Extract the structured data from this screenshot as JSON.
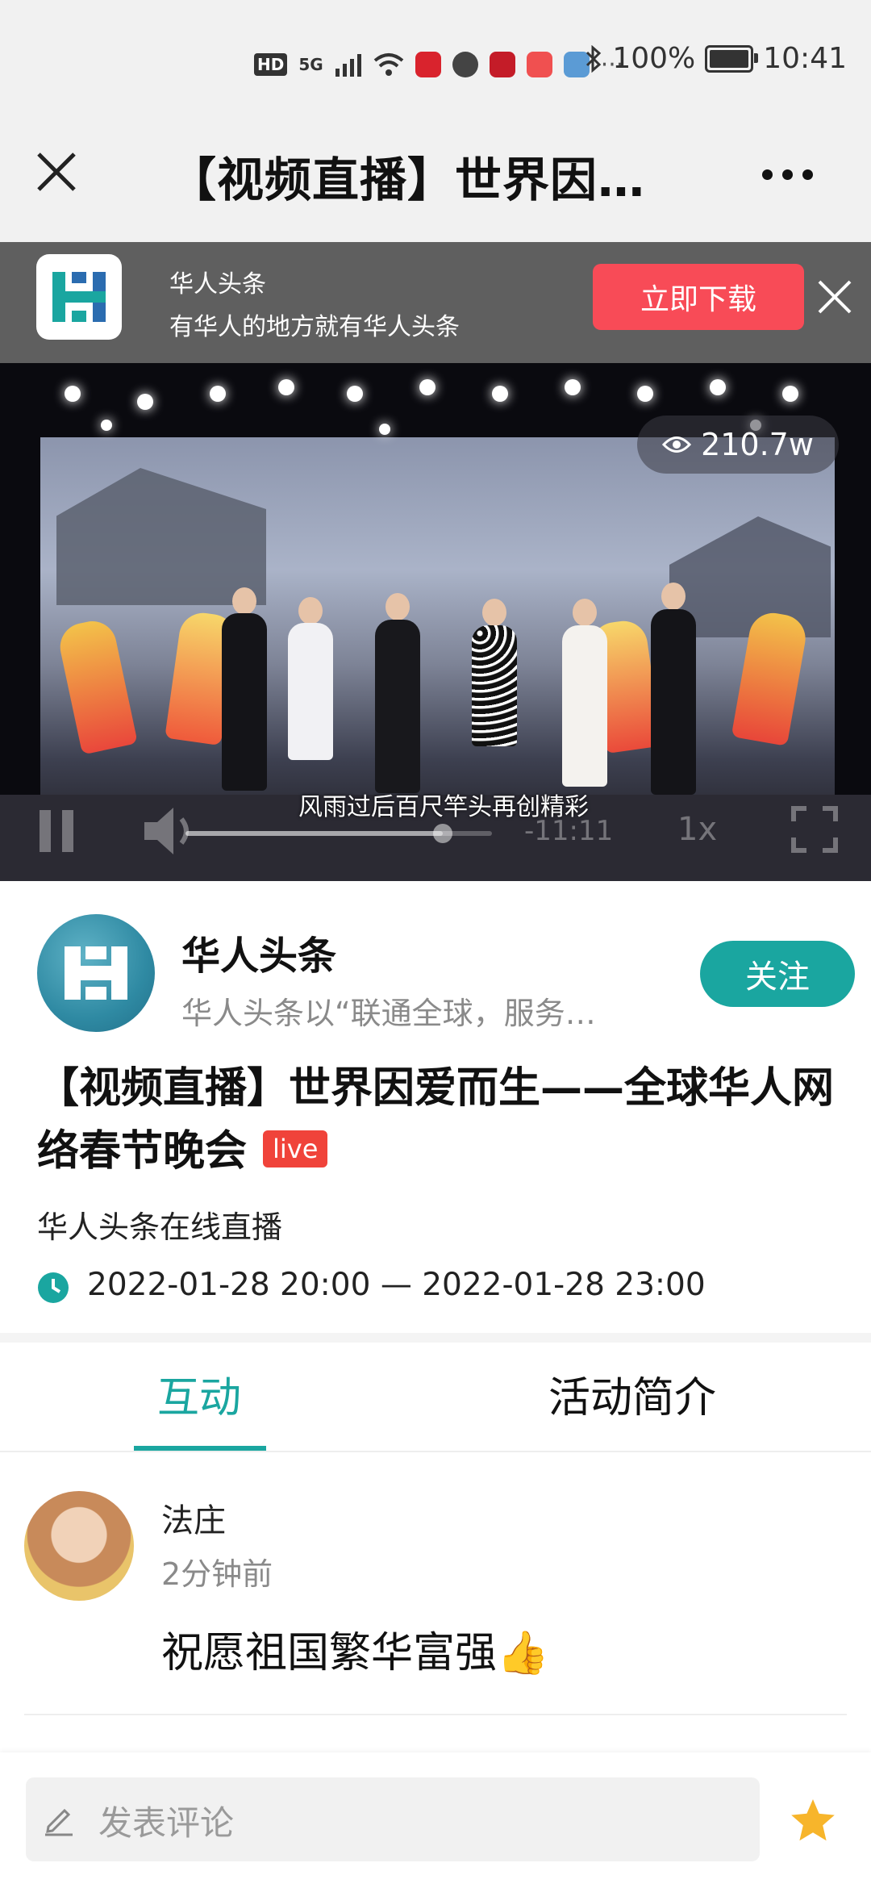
{
  "status_bar": {
    "network_badge": "HD",
    "network_type": "5G",
    "battery": "100%",
    "time": "10:41",
    "more_indicator": "···"
  },
  "titlebar": {
    "title": "【视频直播】世界因…",
    "close_icon": "close-icon",
    "more_icon": "more-dots-icon"
  },
  "banner": {
    "app_name": "华人头条",
    "slogan": "有华人的地方就有华人头条",
    "download_label": "立即下载"
  },
  "video": {
    "views": "210.7w",
    "subtitle": "风雨过后百尺竿头再创精彩",
    "time_left": "-11:11",
    "speed": "1x",
    "progress": 0.84
  },
  "channel": {
    "name": "华人头条",
    "description": "华人头条以“联通全球，服务…",
    "follow_label": "关注"
  },
  "event": {
    "title": "【视频直播】世界因爱而生——全球华人网络春节晚会",
    "badge": "live",
    "organizer": "华人头条在线直播",
    "time_range": "2022-01-28 20:00 — 2022-01-28 23:00"
  },
  "tabs": [
    {
      "label": "互动",
      "active": true
    },
    {
      "label": "活动简介",
      "active": false
    }
  ],
  "comments": [
    {
      "user": "法庄",
      "time": "2分钟前",
      "text": "祝愿祖国繁华富强👍"
    }
  ],
  "composer": {
    "placeholder": "发表评论"
  },
  "colors": {
    "accent": "#1aa6a0",
    "download": "#f84b57",
    "live": "#f0433a",
    "banner_bg": "#5f5f5f"
  }
}
